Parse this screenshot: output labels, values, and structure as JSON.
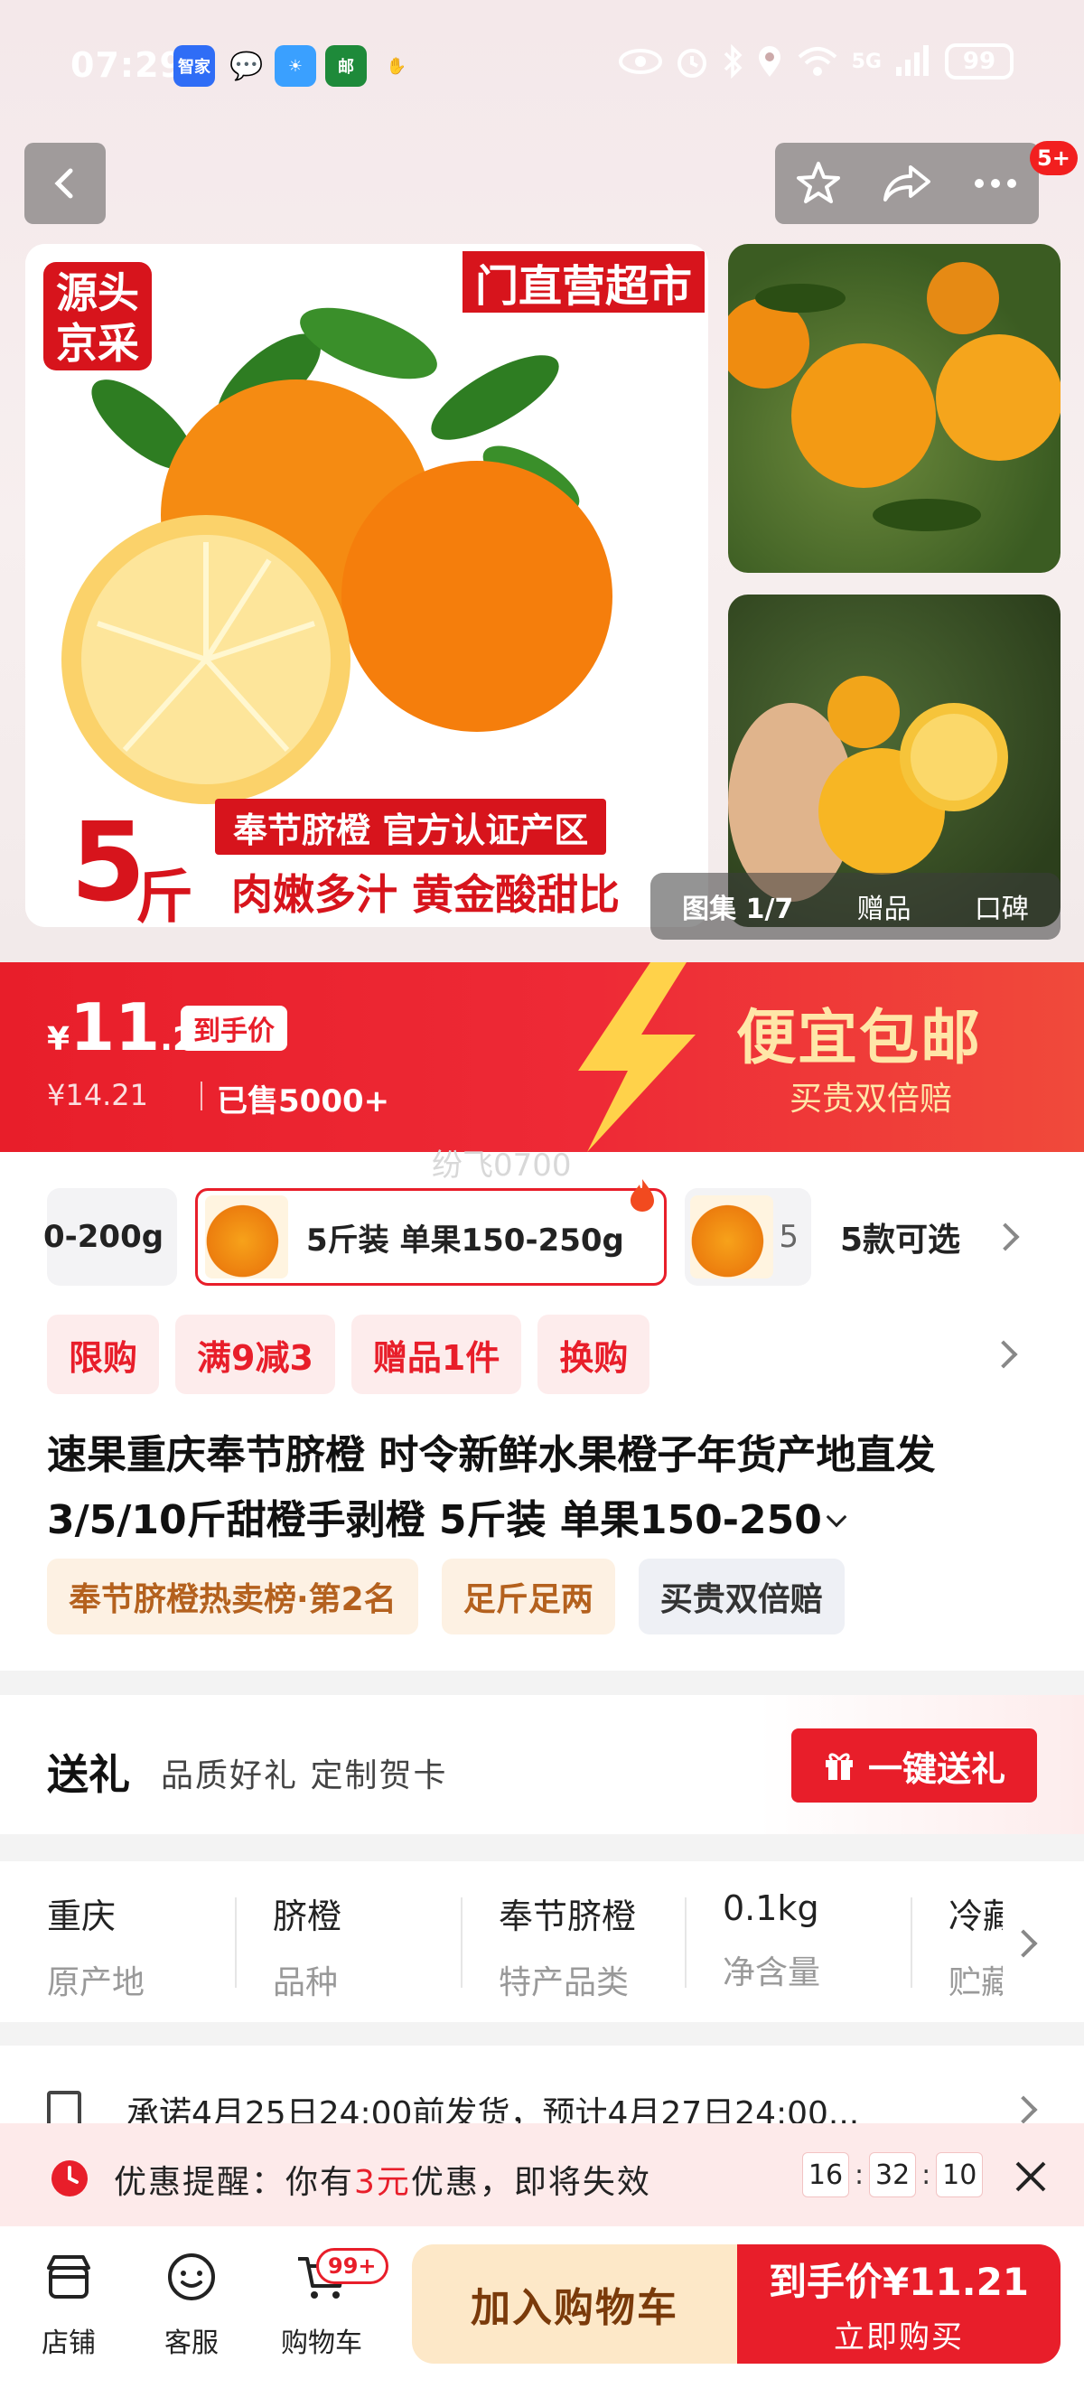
{
  "status_bar": {
    "time": "07:29",
    "apps": [
      {
        "label": "智家"
      },
      {
        "label": "Hi"
      },
      {
        "label": "☀"
      },
      {
        "label": "邮"
      },
      {
        "label": "✋"
      }
    ],
    "network": "5G",
    "battery": "99"
  },
  "nav": {
    "messages_badge": "5+"
  },
  "gallery": {
    "main": {
      "source_badge": "源头\n京采",
      "top_banner": "门直营超市",
      "strip": "奉节脐橙  官方认证产区",
      "weight_num": "5",
      "weight_unit": "斤",
      "slogan": "肉嫩多汁 黄金酸甜比"
    },
    "tabs": [
      "图集 1/7",
      "赠品",
      "口碑"
    ]
  },
  "price": {
    "currency": "¥",
    "integer": "11",
    "decimal": ".21",
    "tag": "到手价",
    "original": "¥14.21",
    "sold": "已售5000+",
    "promo_title": "便宜包邮",
    "promo_sub": "买贵双倍赔"
  },
  "watermark": "纷飞0700",
  "sku": {
    "items": [
      {
        "label": "0-200g"
      },
      {
        "label": "5斤装 单果150-250g"
      }
    ],
    "count_prefix": "5",
    "count_label": "5款可选"
  },
  "promo_tags": [
    "限购",
    "满9减3",
    "赠品1件",
    "换购"
  ],
  "product_title": "速果重庆奉节脐橙 时令新鲜水果橙子年货产地直发3/5/10斤甜橙手剥橙 5斤装 单果150-250",
  "rank_tags": [
    {
      "label": "奉节脐橙热卖榜·第2名",
      "style": "gold"
    },
    {
      "label": "足斤足两",
      "style": "gold"
    },
    {
      "label": "买贵双倍赔",
      "style": "gray"
    }
  ],
  "gift": {
    "title": "送礼",
    "subtitle": "品质好礼 定制贺卡",
    "button": "一键送礼"
  },
  "specs": [
    {
      "value": "重庆",
      "key": "原产地"
    },
    {
      "value": "脐橙",
      "key": "品种"
    },
    {
      "value": "奉节脐橙",
      "key": "特产品类"
    },
    {
      "value": "0.1kg",
      "key": "净含量"
    },
    {
      "value": "冷藏",
      "key": "贮藏"
    }
  ],
  "shipping": {
    "text": "承诺4月25日24:00前发货，预计4月27日24:00..."
  },
  "reminder": {
    "prefix": "优惠提醒：你有",
    "amount": "3元",
    "suffix": "优惠，即将失效",
    "timer": [
      "16",
      "32",
      "10"
    ]
  },
  "bottom": {
    "store": "店铺",
    "service": "客服",
    "cart": "购物车",
    "cart_badge": "99+",
    "add_cart": "加入购物车",
    "buy_line1": "到手价¥11.21",
    "buy_line2": "立即购买"
  },
  "colors": {
    "brand_red": "#e81e2a",
    "promo_gold": "#ffe6a8",
    "rank_gold": "#b4611e"
  }
}
